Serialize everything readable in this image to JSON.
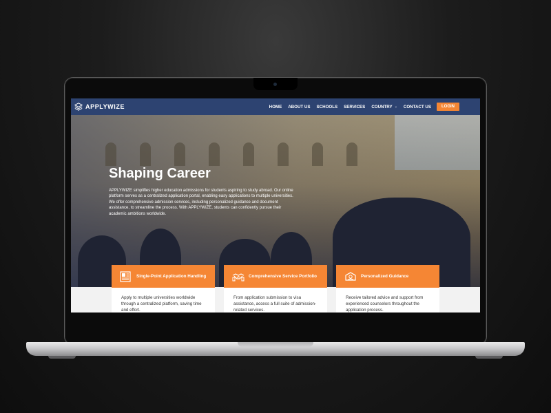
{
  "nav": {
    "logo_text": "APPLYWIZE",
    "items": [
      "HOME",
      "ABOUT US",
      "SCHOOLS",
      "SERVICES",
      "COUNTRY",
      "CONTACT US"
    ],
    "login_label": "LOGIN"
  },
  "hero": {
    "title": "Shaping Career",
    "description": "APPLYWIZE simplifies higher education admissions for students aspiring to study abroad. Our online platform serves as a centralized application portal, enabling easy applications to multiple universities. We offer comprehensive admission services, including personalized guidance and document assistance, to streamline the process. With APPLYWIZE, students can confidently pursue their academic ambitions worldwide."
  },
  "cards": [
    {
      "icon": "document-icon",
      "title": "Single-Point Application Handling",
      "text": "Apply to multiple universities worldwide through a centralized platform, saving time and effort."
    },
    {
      "icon": "handshake-icon",
      "title": "Comprehensive Service Portfolio",
      "text": "From application submission to visa assistance, access a full suite of admission-related services."
    },
    {
      "icon": "guidance-icon",
      "title": "Personalized Guidance",
      "text": "Receive tailored advice and support from experienced counselors throughout the application process."
    }
  ],
  "colors": {
    "nav": "#2d4371",
    "accent": "#f58634"
  }
}
